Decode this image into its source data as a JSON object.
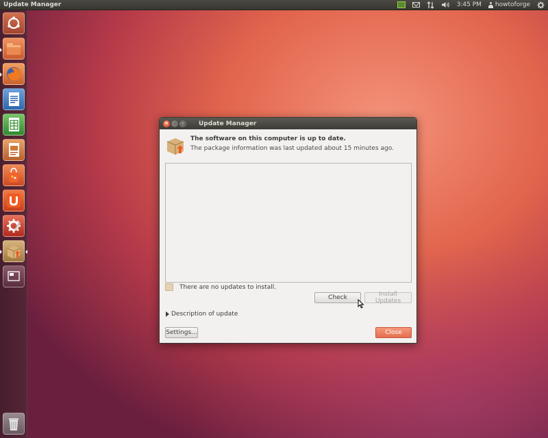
{
  "top_panel": {
    "app_title": "Update Manager",
    "clock": "3:45 PM",
    "user": "howtoforge",
    "icons": [
      "network-icon",
      "mail-icon",
      "transfer-arrows-icon",
      "volume-icon",
      "person-icon",
      "gear-icon"
    ]
  },
  "launcher": {
    "items": [
      {
        "name": "ubuntu-dash-icon",
        "color": "#c85a3a"
      },
      {
        "name": "home-folder-icon",
        "color": "#e0744a"
      },
      {
        "name": "firefox-icon",
        "color": "#e86a20"
      },
      {
        "name": "writer-icon",
        "color": "#2f6fb4"
      },
      {
        "name": "calc-icon",
        "color": "#3a9a3a"
      },
      {
        "name": "impress-icon",
        "color": "#c0642a"
      },
      {
        "name": "software-center-icon",
        "color": "#dd5a2a"
      },
      {
        "name": "ubuntu-one-icon",
        "color": "#d44a1e"
      },
      {
        "name": "system-settings-icon",
        "color": "#c03020"
      },
      {
        "name": "update-manager-icon",
        "color": "#b8955a"
      },
      {
        "name": "workspace-switcher-icon",
        "color": "#7a4a5a"
      },
      {
        "name": "trash-icon",
        "color": "#8a8a8a"
      }
    ]
  },
  "dialog": {
    "title": "Update Manager",
    "headline": "The software on this computer is up to date.",
    "subline": "The package information was last updated about 15 minutes ago.",
    "status": "There are no updates to install.",
    "check_label": "Check",
    "install_label": "Install Updates",
    "description_label": "Description of update",
    "settings_label": "Settings...",
    "close_label": "Close"
  },
  "colors": {
    "accent": "#e56e4f",
    "panel": "#3c3b37",
    "dialog_bg": "#f2f1f0"
  }
}
